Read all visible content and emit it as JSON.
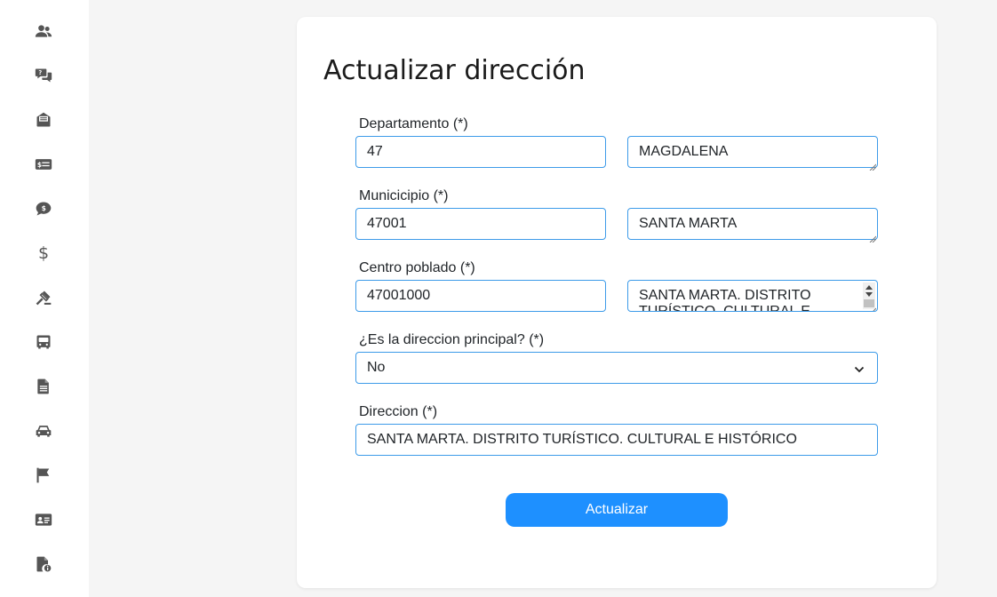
{
  "sidebar": {
    "items": [
      {
        "icon": "users-icon"
      },
      {
        "icon": "questions-chat-icon"
      },
      {
        "icon": "envelope-open-icon"
      },
      {
        "icon": "money-check-icon"
      },
      {
        "icon": "comment-dollar-icon"
      },
      {
        "icon": "dollar-icon",
        "glyph": "$"
      },
      {
        "icon": "gavel-icon"
      },
      {
        "icon": "bus-icon"
      },
      {
        "icon": "file-lines-icon"
      },
      {
        "icon": "car-icon"
      },
      {
        "icon": "flag-icon"
      },
      {
        "icon": "id-card-icon"
      },
      {
        "icon": "file-info-icon"
      }
    ]
  },
  "form": {
    "title": "Actualizar dirección",
    "departamento": {
      "label": "Departamento (*)",
      "code": "47",
      "name": "MAGDALENA"
    },
    "municipio": {
      "label": "Municicipio (*)",
      "code": "47001",
      "name": "SANTA MARTA"
    },
    "centro_poblado": {
      "label": "Centro poblado (*)",
      "code": "47001000",
      "name": "SANTA MARTA. DISTRITO TURÍSTICO. CULTURAL E"
    },
    "principal": {
      "label": "¿Es la direccion principal? (*)",
      "selected": "No"
    },
    "direccion": {
      "label": "Direccion (*)",
      "value": "SANTA MARTA. DISTRITO TURÍSTICO. CULTURAL E HISTÓRICO"
    },
    "submit_label": "Actualizar"
  },
  "colors": {
    "accent": "#1e90ff",
    "input_border": "#3d9be9",
    "background": "#f5f5f5",
    "icon": "#555555"
  }
}
